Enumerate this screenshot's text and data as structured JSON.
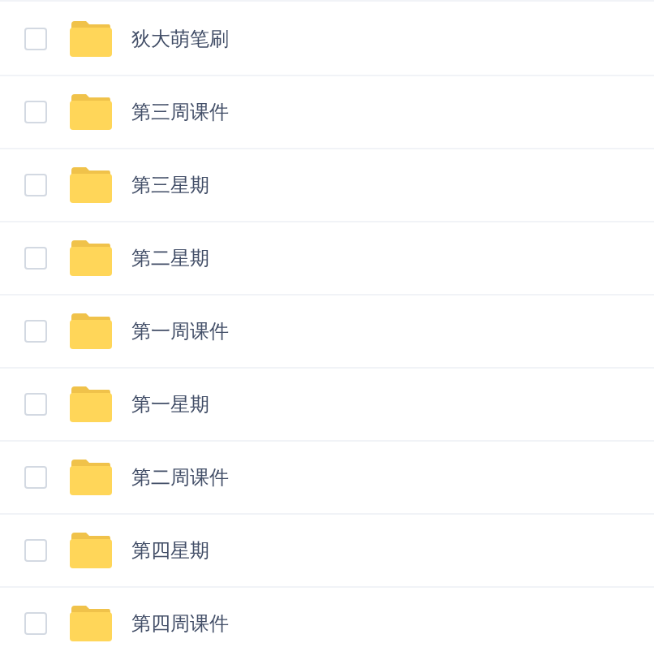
{
  "files": [
    {
      "name": "狄大萌笔刷",
      "checked": false
    },
    {
      "name": "第三周课件",
      "checked": false
    },
    {
      "name": "第三星期",
      "checked": false
    },
    {
      "name": "第二星期",
      "checked": false
    },
    {
      "name": "第一周课件",
      "checked": false
    },
    {
      "name": "第一星期",
      "checked": false
    },
    {
      "name": "第二周课件",
      "checked": false
    },
    {
      "name": "第四星期",
      "checked": false
    },
    {
      "name": "第四周课件",
      "checked": false
    }
  ]
}
